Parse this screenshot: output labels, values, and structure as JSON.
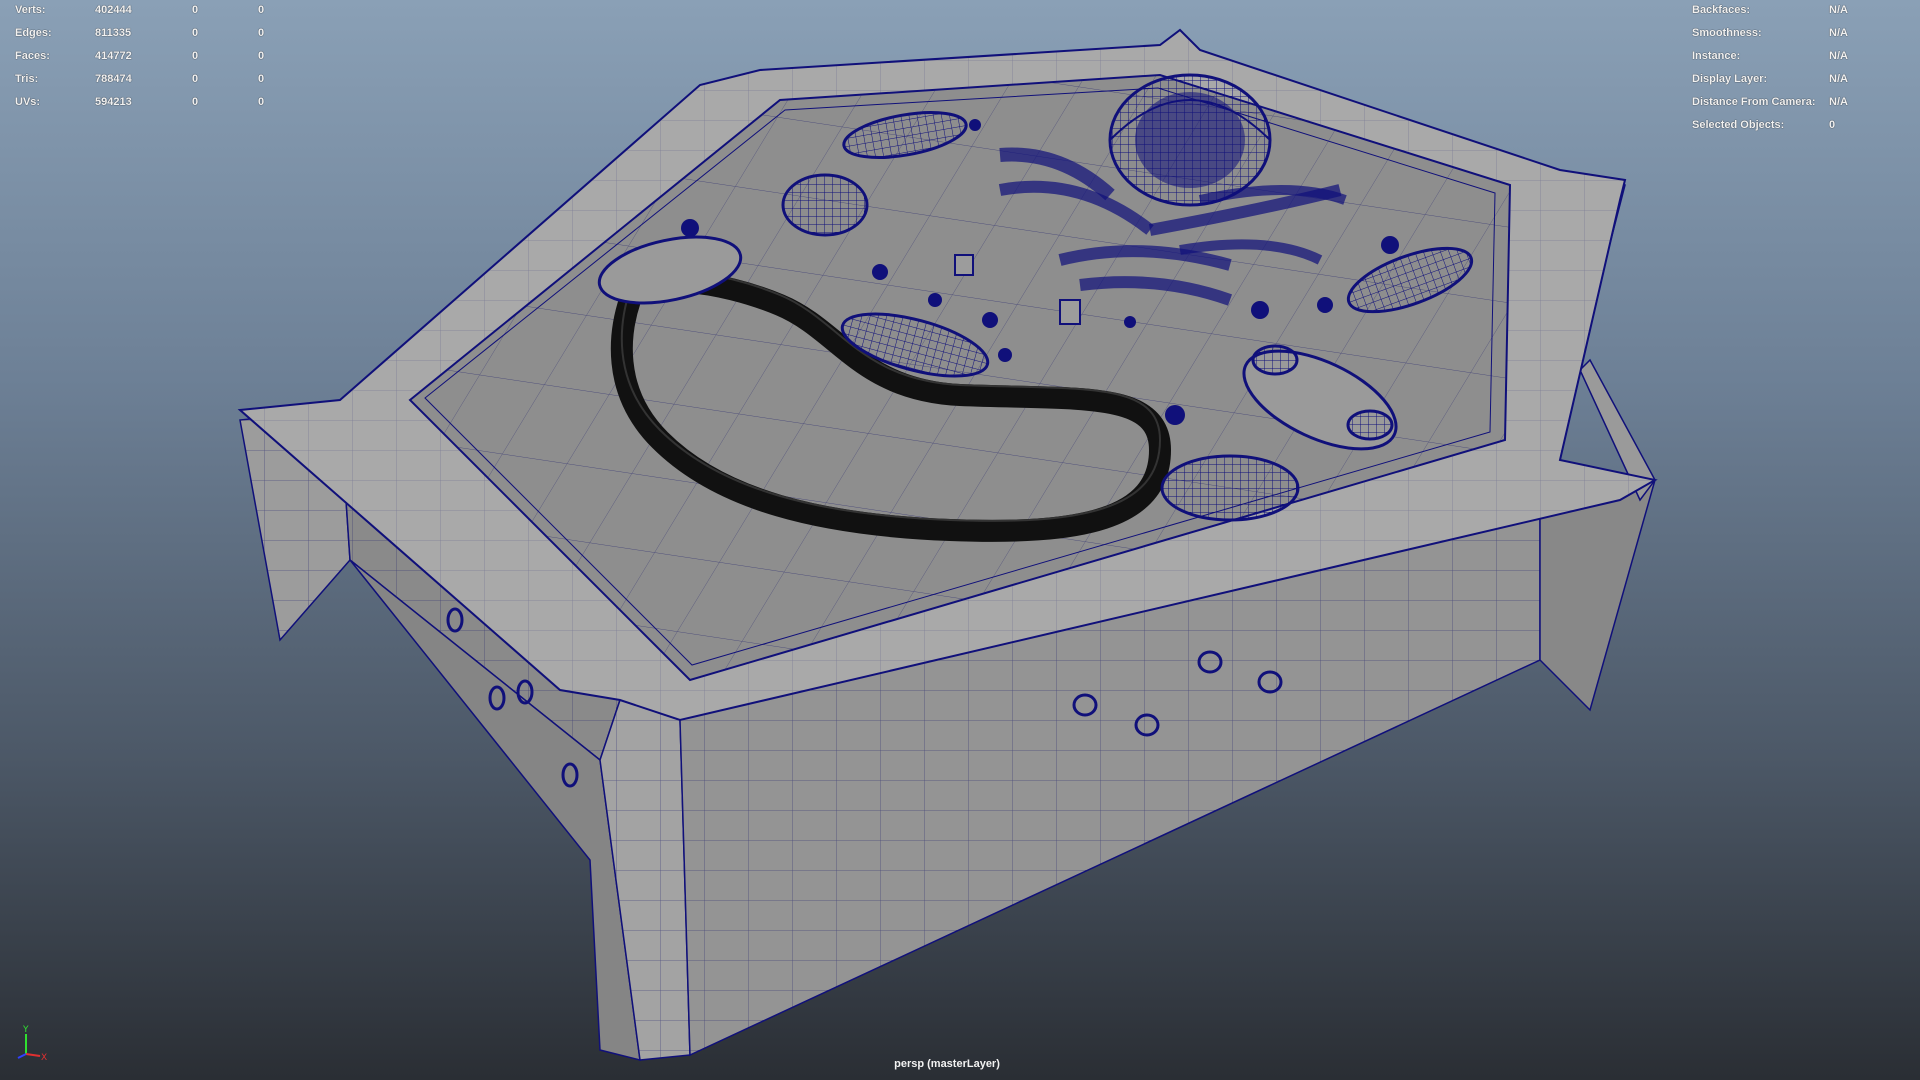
{
  "hud_left": {
    "rows": [
      {
        "label": "Verts:",
        "value": "402444",
        "sel": "0",
        "uv": "0"
      },
      {
        "label": "Edges:",
        "value": "811335",
        "sel": "0",
        "uv": "0"
      },
      {
        "label": "Faces:",
        "value": "414772",
        "sel": "0",
        "uv": "0"
      },
      {
        "label": "Tris:",
        "value": "788474",
        "sel": "0",
        "uv": "0"
      },
      {
        "label": "UVs:",
        "value": "594213",
        "sel": "0",
        "uv": "0"
      }
    ]
  },
  "hud_right": {
    "rows": [
      {
        "label": "Backfaces:",
        "value": "N/A"
      },
      {
        "label": "Smoothness:",
        "value": "N/A"
      },
      {
        "label": "Instance:",
        "value": "N/A"
      },
      {
        "label": "Display Layer:",
        "value": "N/A"
      },
      {
        "label": "Distance From Camera:",
        "value": "N/A"
      },
      {
        "label": "Selected Objects:",
        "value": "0"
      }
    ]
  },
  "camera": {
    "label": "persp (masterLayer)"
  },
  "axis": {
    "y": "Y",
    "x": "X"
  },
  "colors": {
    "wire": "#10107a",
    "surface": "#8e8e8e",
    "bg_top": "#8aa0b6",
    "bg_bottom": "#2a2e34"
  }
}
